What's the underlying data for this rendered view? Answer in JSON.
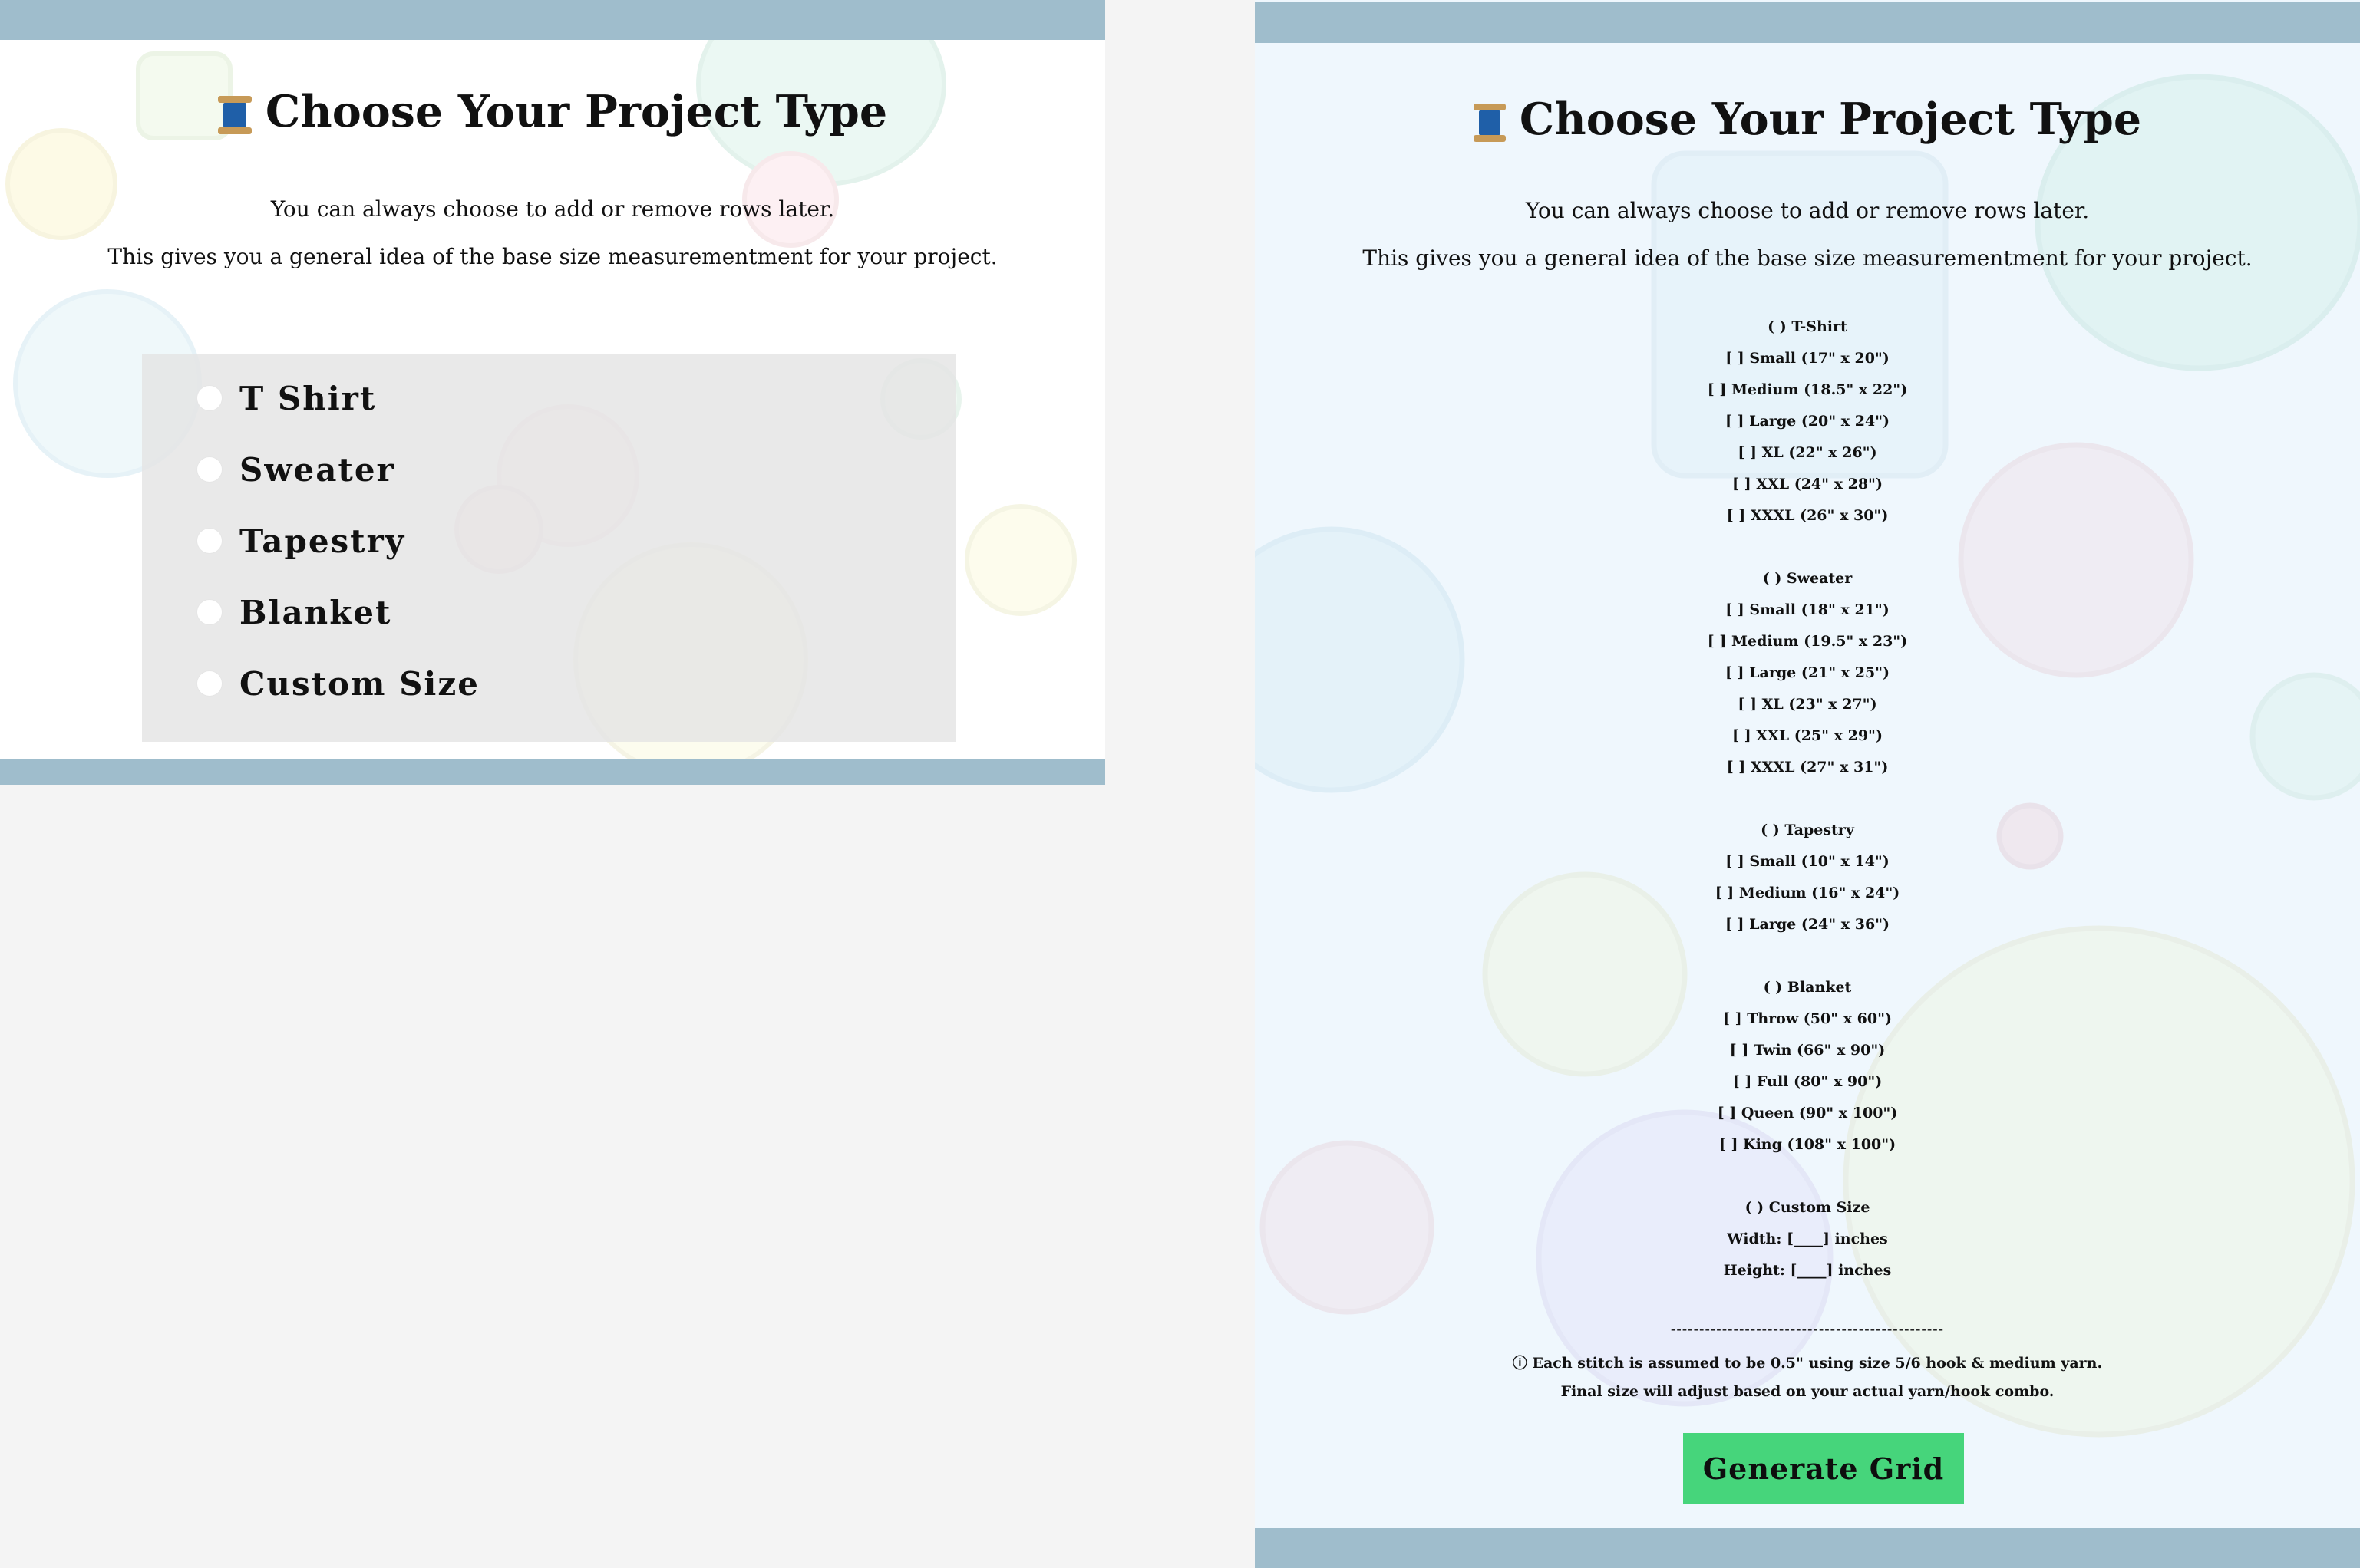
{
  "left_panel": {
    "title": "Choose Your Project Type",
    "subtitle_line1": "You can always choose to add or remove rows later.",
    "subtitle_line2": "This gives you a general idea of the base size measurementment for your project.",
    "options": [
      {
        "label": "T Shirt",
        "selected": false
      },
      {
        "label": "Sweater",
        "selected": false
      },
      {
        "label": "Tapestry",
        "selected": false
      },
      {
        "label": "Blanket",
        "selected": false
      },
      {
        "label": "Custom Size",
        "selected": false
      }
    ]
  },
  "right_panel": {
    "title": "Choose Your Project Type",
    "subtitle_line1": "You can always choose to add or remove rows later.",
    "subtitle_line2": "This gives you a general idea of the base size measurementment for your project.",
    "tshirt": {
      "header": "( ) T-Shirt",
      "sizes": [
        "[ ] Small (17\" x 20\")",
        "[ ] Medium (18.5\" x 22\")",
        "[ ] Large (20\" x 24\")",
        "[ ] XL (22\" x 26\")",
        "[ ] XXL (24\" x 28\")",
        "[ ] XXXL (26\" x 30\")"
      ]
    },
    "sweater": {
      "header": "( ) Sweater",
      "sizes": [
        "[ ] Small (18\" x 21\")",
        "[ ] Medium (19.5\" x 23\")",
        "[ ] Large (21\" x 25\")",
        "[ ] XL (23\" x 27\")",
        "[ ] XXL (25\" x 29\")",
        "[ ] XXXL (27\" x 31\")"
      ]
    },
    "tapestry": {
      "header": "( ) Tapestry",
      "sizes": [
        "[ ] Small (10\" x 14\")",
        "[ ] Medium (16\" x 24\")",
        "[ ] Large (24\" x 36\")"
      ]
    },
    "blanket": {
      "header": "( ) Blanket",
      "sizes": [
        "[ ] Throw (50\" x 60\")",
        "[ ] Twin (66\" x 90\")",
        "[ ] Full (80\" x 90\")",
        "[ ] Queen (90\" x 100\")",
        "[ ] King (108\" x 100\")"
      ]
    },
    "custom": {
      "header": "( ) Custom Size",
      "width_line": "Width:  [____] inches",
      "height_line": "Height: [____] inches"
    },
    "divider": "------------------------------------------------",
    "note_line1": "ⓘ Each stitch is assumed to be 0.5\" using size 5/6 hook & medium yarn.",
    "note_line2": "Final size will adjust based on your actual yarn/hook combo.",
    "generate_button_label": "Generate Grid"
  },
  "colors": {
    "bar": "#9fbdcc",
    "left_background": "#ffffff",
    "right_background": "#eff7fd",
    "page_background": "#f4f4f4",
    "generate_button": "#46d57b",
    "spool_thread": "#1f5fa8",
    "spool_wood": "#c79a57"
  },
  "icons": {
    "title_icon": "spool-of-thread-icon",
    "radio": "radio-button-icon",
    "info": "info-icon"
  }
}
